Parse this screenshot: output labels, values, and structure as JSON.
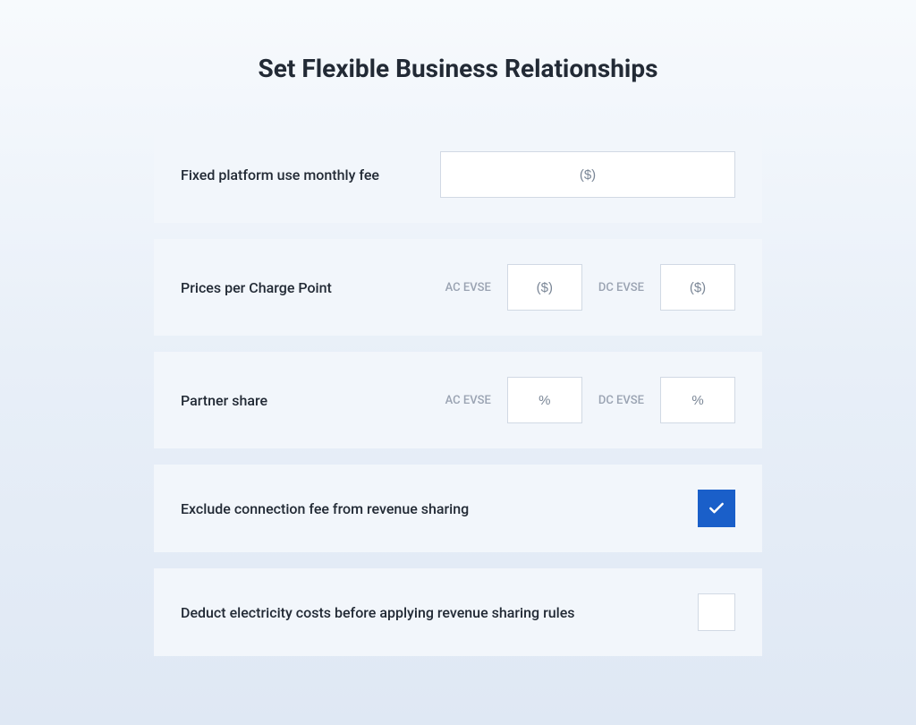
{
  "title": "Set Flexible Business Relationships",
  "rows": {
    "fixed_fee": {
      "label": "Fixed platform use monthly fee",
      "placeholder": "($)"
    },
    "prices_per_cp": {
      "label": "Prices per Charge Point",
      "ac_label": "AC EVSE",
      "ac_placeholder": "($)",
      "dc_label": "DC EVSE",
      "dc_placeholder": "($)"
    },
    "partner_share": {
      "label": "Partner share",
      "ac_label": "AC EVSE",
      "ac_placeholder": "%",
      "dc_label": "DC EVSE",
      "dc_placeholder": "%"
    },
    "exclude_conn_fee": {
      "label": "Exclude connection fee from revenue sharing",
      "checked": true
    },
    "deduct_elec": {
      "label": "Deduct electricity costs before applying revenue sharing rules",
      "checked": false
    }
  },
  "colors": {
    "accent": "#1a5fc9",
    "card_bg": "#f2f6fb",
    "text": "#222a35",
    "muted": "#9aa3b2"
  }
}
